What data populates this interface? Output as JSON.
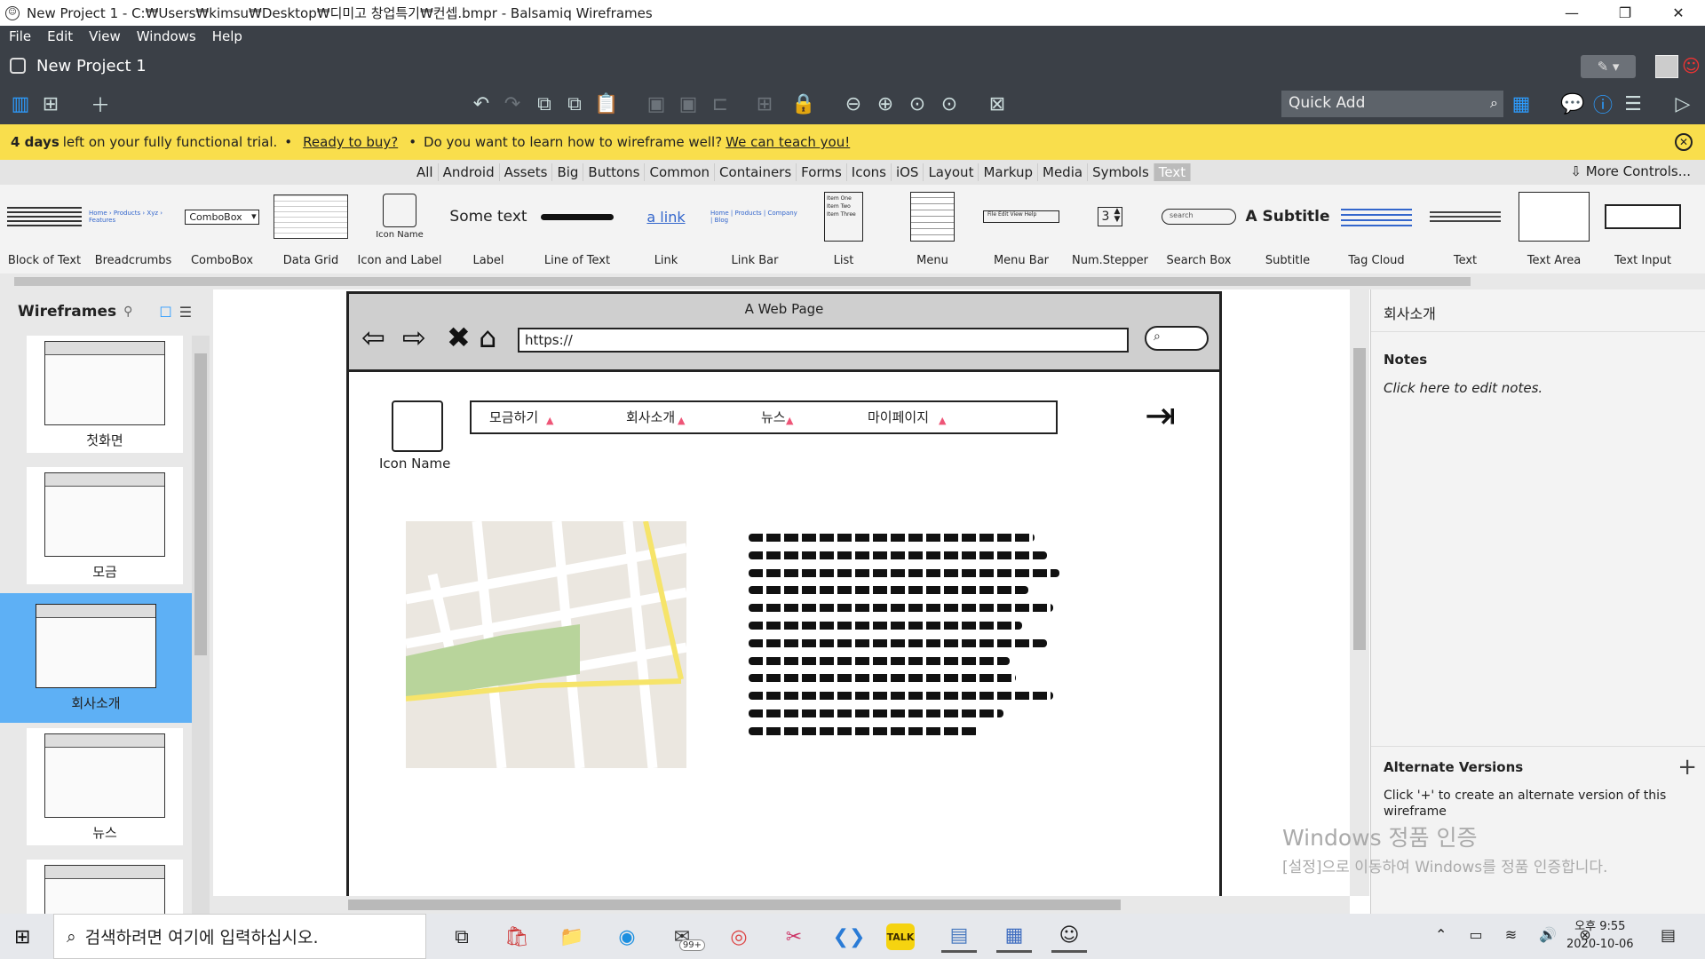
{
  "window": {
    "title": "New Project 1 - C:₩Users₩kimsu₩Desktop₩디미고 창업특기₩컨셉.bmpr - Balsamiq Wireframes",
    "controls": [
      "—",
      "❐",
      "✕"
    ]
  },
  "menu": [
    "File",
    "Edit",
    "View",
    "Windows",
    "Help"
  ],
  "project": {
    "title": "New Project 1"
  },
  "quick_add": {
    "placeholder": "Quick Add"
  },
  "banner": {
    "bold": "4 days",
    "text1": "left on your fully functional trial.",
    "link1": "Ready to buy?",
    "text2": "Do you want to learn how to wireframe well?",
    "link2": "We can teach you!"
  },
  "filters": [
    "All",
    "Android",
    "Assets",
    "Big",
    "Buttons",
    "Common",
    "Containers",
    "Forms",
    "Icons",
    "iOS",
    "Layout",
    "Markup",
    "Media",
    "Symbols",
    "Text"
  ],
  "active_filter": "Text",
  "more_controls": "More Controls...",
  "library": {
    "items": [
      "Block of Text",
      "Breadcrumbs",
      "ComboBox",
      "Data Grid",
      "Icon and Label",
      "Label",
      "Line of Text",
      "Link",
      "Link Bar",
      "List",
      "Menu",
      "Menu Bar",
      "Num.Stepper",
      "Search Box",
      "Subtitle",
      "Tag Cloud",
      "Text",
      "Text Area",
      "Text Input"
    ],
    "previews": {
      "combobox": "ComboBox",
      "icon_name": "Icon Name",
      "label": "Some text",
      "link": "a link",
      "stepper": "3",
      "search": "search",
      "subtitle": "A Subtitle",
      "list": [
        "Item One",
        "Item Two",
        "Item Three"
      ]
    }
  },
  "left_panel": {
    "title": "Wireframes",
    "pages": [
      "첫화면",
      "모금",
      "회사소개",
      "뉴스"
    ],
    "selected_page": "회사소개"
  },
  "wireframe": {
    "browser_title": "A Web Page",
    "url": "https://",
    "icon_label": "Icon Name",
    "nav": [
      "모금하기",
      "회사소개",
      "뉴스",
      "마이페이지"
    ]
  },
  "right_panel": {
    "title": "회사소개",
    "notes_heading": "Notes",
    "notes_placeholder": "Click here to edit notes.",
    "alt_heading": "Alternate Versions",
    "alt_body": "Click '+' to create an alternate version of this wireframe"
  },
  "watermark": {
    "line1": "Windows 정품 인증",
    "line2": "[설정]으로 이동하여 Windows를 정품 인증합니다."
  },
  "taskbar": {
    "search_placeholder": "검색하려면 여기에 입력하십시오.",
    "mail_badge": "99+",
    "clock_time": "오후 9:55",
    "clock_date": "2020-10-06"
  },
  "colors": {
    "dark_chrome": "#3b4047",
    "banner": "#f9de4c",
    "selection": "#5eb0f5",
    "accent_blue": "#2c9cff"
  }
}
